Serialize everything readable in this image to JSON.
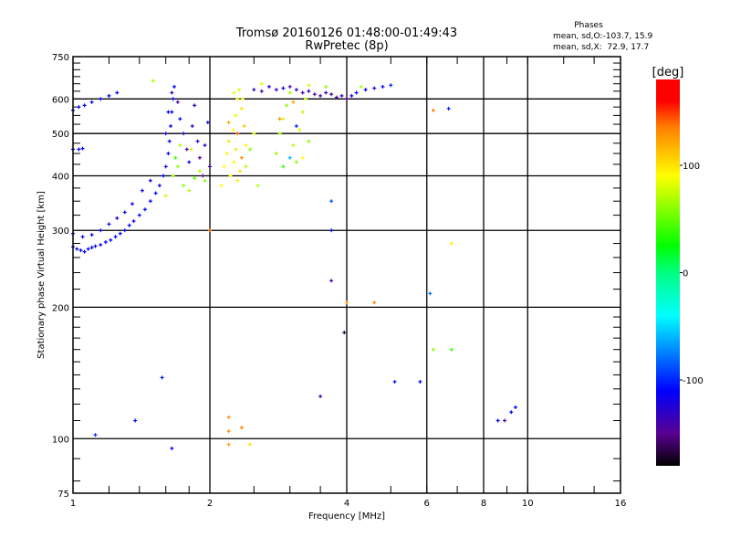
{
  "chart_data": {
    "type": "scatter",
    "title": "Tromsø 20160126 01:48:00-01:49:43",
    "subtitle": "RwPretec (8p)",
    "xlabel": "Frequency [MHz]",
    "ylabel": "Stationary phase Virtual Height [km]",
    "xscale": "log",
    "yscale": "log",
    "xlim": [
      1,
      16
    ],
    "ylim": [
      75,
      750
    ],
    "x_ticks": [
      1,
      2,
      4,
      6,
      8,
      10,
      16
    ],
    "x_tick_labels": [
      "1",
      "2",
      "4",
      "6",
      "8",
      "10",
      "16"
    ],
    "x_grid": [
      2,
      4,
      6,
      8,
      10
    ],
    "y_ticks": [
      75,
      100,
      200,
      300,
      400,
      500,
      600,
      750
    ],
    "y_tick_labels": [
      "75",
      "100",
      "200",
      "300",
      "400",
      "500",
      "600",
      "750"
    ],
    "y_grid": [
      100,
      200,
      300,
      400,
      500,
      600
    ],
    "grid": true,
    "legend": {
      "title": "Phases",
      "line_o": "mean, sd,O:-103.7, 15.9",
      "line_x": "mean, sd,X:  72.9, 17.7",
      "placement": "top-right"
    },
    "colorbar": {
      "label": "[deg]",
      "range": [
        -180,
        180
      ],
      "ticks": [
        100,
        0,
        -100
      ],
      "tick_labels": [
        "100",
        "0",
        "-100"
      ],
      "stops": [
        {
          "v": -180,
          "c": "#000000"
        },
        {
          "v": -150,
          "c": "#5a0090"
        },
        {
          "v": -110,
          "c": "#0000ff"
        },
        {
          "v": -40,
          "c": "#00ffff"
        },
        {
          "v": 0,
          "c": "#00ff80"
        },
        {
          "v": 25,
          "c": "#00ff00"
        },
        {
          "v": 90,
          "c": "#ffff00"
        },
        {
          "v": 135,
          "c": "#ff8000"
        },
        {
          "v": 160,
          "c": "#ff0000"
        },
        {
          "v": 180,
          "c": "#ff0000"
        }
      ]
    },
    "points_format": [
      "frequency_MHz",
      "height_km",
      "phase_deg"
    ],
    "points": [
      [
        1.0,
        275,
        -110
      ],
      [
        1.02,
        272,
        -110
      ],
      [
        1.04,
        270,
        -110
      ],
      [
        1.06,
        268,
        -110
      ],
      [
        1.08,
        272,
        -110
      ],
      [
        1.1,
        274,
        -110
      ],
      [
        1.12,
        276,
        -110
      ],
      [
        1.15,
        278,
        -110
      ],
      [
        1.18,
        282,
        -110
      ],
      [
        1.21,
        285,
        -110
      ],
      [
        1.24,
        290,
        -110
      ],
      [
        1.27,
        295,
        -110
      ],
      [
        1.3,
        300,
        -110
      ],
      [
        1.33,
        308,
        -110
      ],
      [
        1.36,
        315,
        -110
      ],
      [
        1.4,
        325,
        -110
      ],
      [
        1.44,
        335,
        -110
      ],
      [
        1.48,
        350,
        -110
      ],
      [
        1.52,
        365,
        -110
      ],
      [
        1.55,
        380,
        -110
      ],
      [
        1.58,
        400,
        -110
      ],
      [
        1.6,
        420,
        -110
      ],
      [
        1.62,
        450,
        -110
      ],
      [
        1.63,
        480,
        -110
      ],
      [
        1.64,
        520,
        -110
      ],
      [
        1.65,
        560,
        -110
      ],
      [
        1.66,
        600,
        -110
      ],
      [
        1.67,
        640,
        -110
      ],
      [
        1.0,
        295,
        -115
      ],
      [
        1.05,
        290,
        -115
      ],
      [
        1.1,
        293,
        -115
      ],
      [
        1.15,
        300,
        -115
      ],
      [
        1.2,
        310,
        -115
      ],
      [
        1.25,
        320,
        -115
      ],
      [
        1.3,
        330,
        -115
      ],
      [
        1.35,
        345,
        -115
      ],
      [
        1.42,
        370,
        -115
      ],
      [
        1.48,
        390,
        -115
      ],
      [
        1.0,
        565,
        -110
      ],
      [
        1.03,
        575,
        -110
      ],
      [
        1.06,
        580,
        -110
      ],
      [
        1.1,
        590,
        -110
      ],
      [
        1.15,
        600,
        -110
      ],
      [
        1.2,
        610,
        -110
      ],
      [
        1.25,
        620,
        -110
      ],
      [
        1.0,
        460,
        -110
      ],
      [
        1.03,
        460,
        -110
      ],
      [
        1.05,
        462,
        -110
      ],
      [
        1.6,
        500,
        -120
      ],
      [
        1.62,
        560,
        -110
      ],
      [
        1.65,
        620,
        -130
      ],
      [
        1.7,
        590,
        -140
      ],
      [
        1.72,
        540,
        -110
      ],
      [
        1.75,
        500,
        -130
      ],
      [
        1.78,
        460,
        -140
      ],
      [
        1.8,
        430,
        -120
      ],
      [
        1.83,
        520,
        -140
      ],
      [
        1.85,
        580,
        -130
      ],
      [
        1.88,
        480,
        -120
      ],
      [
        1.9,
        440,
        -140
      ],
      [
        1.93,
        400,
        -150
      ],
      [
        1.95,
        470,
        -130
      ],
      [
        1.98,
        530,
        -120
      ],
      [
        2.0,
        420,
        -140
      ],
      [
        1.7,
        420,
        60
      ],
      [
        1.75,
        380,
        60
      ],
      [
        1.8,
        370,
        70
      ],
      [
        1.85,
        395,
        50
      ],
      [
        1.68,
        440,
        40
      ],
      [
        1.9,
        410,
        70
      ],
      [
        1.95,
        390,
        60
      ],
      [
        1.72,
        470,
        70
      ],
      [
        1.66,
        400,
        65
      ],
      [
        1.82,
        460,
        75
      ],
      [
        1.6,
        360,
        80
      ],
      [
        2.15,
        420,
        90
      ],
      [
        2.18,
        450,
        95
      ],
      [
        2.2,
        480,
        100
      ],
      [
        2.25,
        510,
        90
      ],
      [
        2.28,
        550,
        85
      ],
      [
        2.3,
        600,
        95
      ],
      [
        2.32,
        630,
        80
      ],
      [
        2.35,
        570,
        100
      ],
      [
        2.38,
        520,
        110
      ],
      [
        2.4,
        470,
        95
      ],
      [
        2.22,
        400,
        90
      ],
      [
        2.26,
        430,
        85
      ],
      [
        2.3,
        390,
        95
      ],
      [
        2.35,
        440,
        130
      ],
      [
        2.2,
        530,
        120
      ],
      [
        2.3,
        500,
        140
      ],
      [
        2.4,
        420,
        70
      ],
      [
        2.45,
        460,
        60
      ],
      [
        2.5,
        500,
        80
      ],
      [
        2.55,
        380,
        70
      ],
      [
        2.12,
        380,
        90
      ],
      [
        2.33,
        410,
        100
      ],
      [
        2.28,
        460,
        100
      ],
      [
        2.36,
        600,
        90
      ],
      [
        2.26,
        620,
        85
      ],
      [
        2.8,
        450,
        60
      ],
      [
        2.85,
        500,
        70
      ],
      [
        2.9,
        540,
        75
      ],
      [
        2.95,
        580,
        60
      ],
      [
        3.0,
        620,
        65
      ],
      [
        3.05,
        470,
        70
      ],
      [
        3.1,
        430,
        60
      ],
      [
        3.15,
        510,
        80
      ],
      [
        3.2,
        560,
        70
      ],
      [
        3.25,
        600,
        75
      ],
      [
        3.3,
        480,
        60
      ],
      [
        2.9,
        420,
        40
      ],
      [
        3.0,
        440,
        -60
      ],
      [
        3.1,
        520,
        -100
      ],
      [
        2.85,
        540,
        130
      ],
      [
        3.05,
        590,
        120
      ],
      [
        3.2,
        440,
        90
      ],
      [
        2.5,
        630,
        -130
      ],
      [
        2.6,
        625,
        -140
      ],
      [
        2.7,
        640,
        -120
      ],
      [
        2.8,
        630,
        -130
      ],
      [
        2.9,
        635,
        -110
      ],
      [
        3.0,
        640,
        -140
      ],
      [
        3.1,
        630,
        -130
      ],
      [
        3.2,
        620,
        -140
      ],
      [
        3.3,
        625,
        -130
      ],
      [
        3.4,
        615,
        -150
      ],
      [
        3.5,
        610,
        -140
      ],
      [
        3.6,
        620,
        -130
      ],
      [
        3.7,
        615,
        -145
      ],
      [
        3.8,
        605,
        -140
      ],
      [
        3.9,
        610,
        -130
      ],
      [
        4.0,
        600,
        -150
      ],
      [
        4.1,
        610,
        -120
      ],
      [
        4.2,
        620,
        -110
      ],
      [
        4.4,
        630,
        -110
      ],
      [
        4.6,
        635,
        -120
      ],
      [
        4.8,
        640,
        -110
      ],
      [
        5.0,
        645,
        -100
      ],
      [
        3.3,
        645,
        80
      ],
      [
        3.6,
        640,
        60
      ],
      [
        4.3,
        640,
        70
      ],
      [
        2.6,
        650,
        80
      ],
      [
        1.12,
        102,
        -100
      ],
      [
        1.37,
        110,
        -110
      ],
      [
        1.57,
        138,
        -105
      ],
      [
        1.65,
        95,
        -110
      ],
      [
        2.2,
        112,
        130
      ],
      [
        2.2,
        104,
        130
      ],
      [
        2.35,
        106,
        135
      ],
      [
        2.2,
        97,
        125
      ],
      [
        2.45,
        97,
        100
      ],
      [
        3.5,
        125,
        -140
      ],
      [
        3.95,
        175,
        -170
      ],
      [
        4.0,
        205,
        120
      ],
      [
        4.6,
        205,
        135
      ],
      [
        5.1,
        135,
        -105
      ],
      [
        5.8,
        135,
        -110
      ],
      [
        6.1,
        215,
        -80
      ],
      [
        6.2,
        160,
        60
      ],
      [
        6.8,
        160,
        40
      ],
      [
        6.8,
        280,
        95
      ],
      [
        6.2,
        565,
        135
      ],
      [
        6.7,
        570,
        -100
      ],
      [
        8.6,
        110,
        -110
      ],
      [
        8.9,
        110,
        -140
      ],
      [
        9.2,
        115,
        -110
      ],
      [
        9.4,
        118,
        -110
      ],
      [
        3.7,
        350,
        -90
      ],
      [
        3.7,
        300,
        -110
      ],
      [
        3.7,
        230,
        -140
      ],
      [
        2.0,
        300,
        140
      ],
      [
        1.5,
        660,
        70
      ]
    ]
  }
}
